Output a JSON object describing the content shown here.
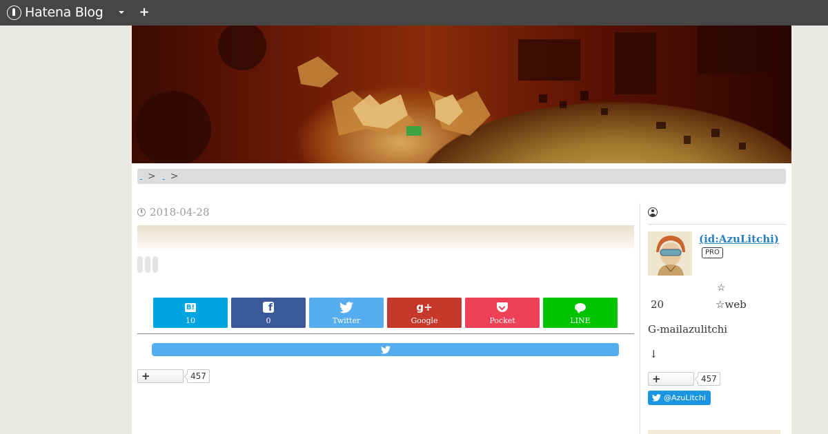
{
  "topbar": {
    "logo_text": "Hatena Blog"
  },
  "breadcrumb": {
    "separators": [
      ">",
      ">"
    ]
  },
  "entry": {
    "date": "2018-04-28"
  },
  "share_buttons": [
    {
      "id": "hatena",
      "icon": "hatena-bookmark-icon",
      "label": "10",
      "color": "#00a4de"
    },
    {
      "id": "facebook",
      "icon": "facebook-icon",
      "label": "0",
      "color": "#3b5998"
    },
    {
      "id": "twitter",
      "icon": "twitter-icon",
      "label": "Twitter",
      "color": "#55acee"
    },
    {
      "id": "google",
      "icon": "google-plus-icon",
      "label": "Google",
      "color": "#c6392a"
    },
    {
      "id": "pocket",
      "icon": "pocket-icon",
      "label": "Pocket",
      "color": "#ee4056"
    },
    {
      "id": "line",
      "icon": "line-icon",
      "label": "LINE",
      "color": "#00c300"
    }
  ],
  "hatena_icon_text": "B!",
  "google_icon_text": "g+",
  "facebook_icon_text": "f",
  "follow_widget": {
    "count": "457"
  },
  "sidebar": {
    "profile_name": " (id:AzuLitchi)",
    "badge": "PRO",
    "star": "☆",
    "count": "20",
    "web_text": "☆web",
    "mail_text": "G-mailazulitchi",
    "arrow": "↓",
    "follow_count": "457",
    "twitter_follow": "@AzuLitchi"
  }
}
